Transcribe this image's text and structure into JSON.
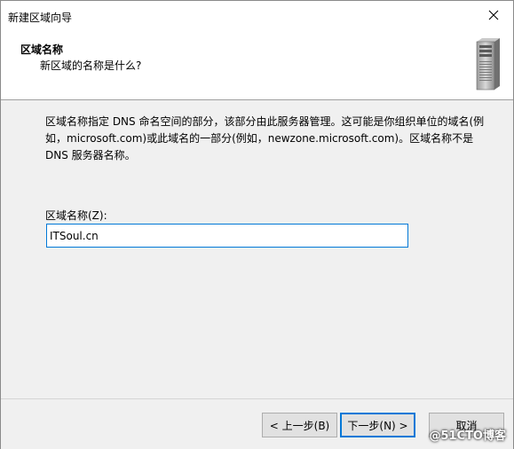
{
  "window": {
    "title": "新建区域向导"
  },
  "header": {
    "title": "区域名称",
    "subtitle": "新区域的名称是什么?"
  },
  "main": {
    "description": "区域名称指定 DNS 命名空间的部分，该部分由此服务器管理。这可能是你组织单位的域名(例如，microsoft.com)或此域名的一部分(例如，newzone.microsoft.com)。区域名称不是 DNS 服务器名称。",
    "zone_name_label": "区域名称(Z):",
    "zone_name_value": "ITSoul.cn"
  },
  "footer": {
    "back_label": "< 上一步(B)",
    "next_label": "下一步(N) >",
    "cancel_label": "取消"
  },
  "watermark": "@51CTO博客",
  "icons": {
    "close": "close-icon",
    "server": "server-icon"
  },
  "colors": {
    "focus": "#0078d7",
    "header_bg": "#ffffff",
    "body_bg": "#f0f0f0"
  }
}
